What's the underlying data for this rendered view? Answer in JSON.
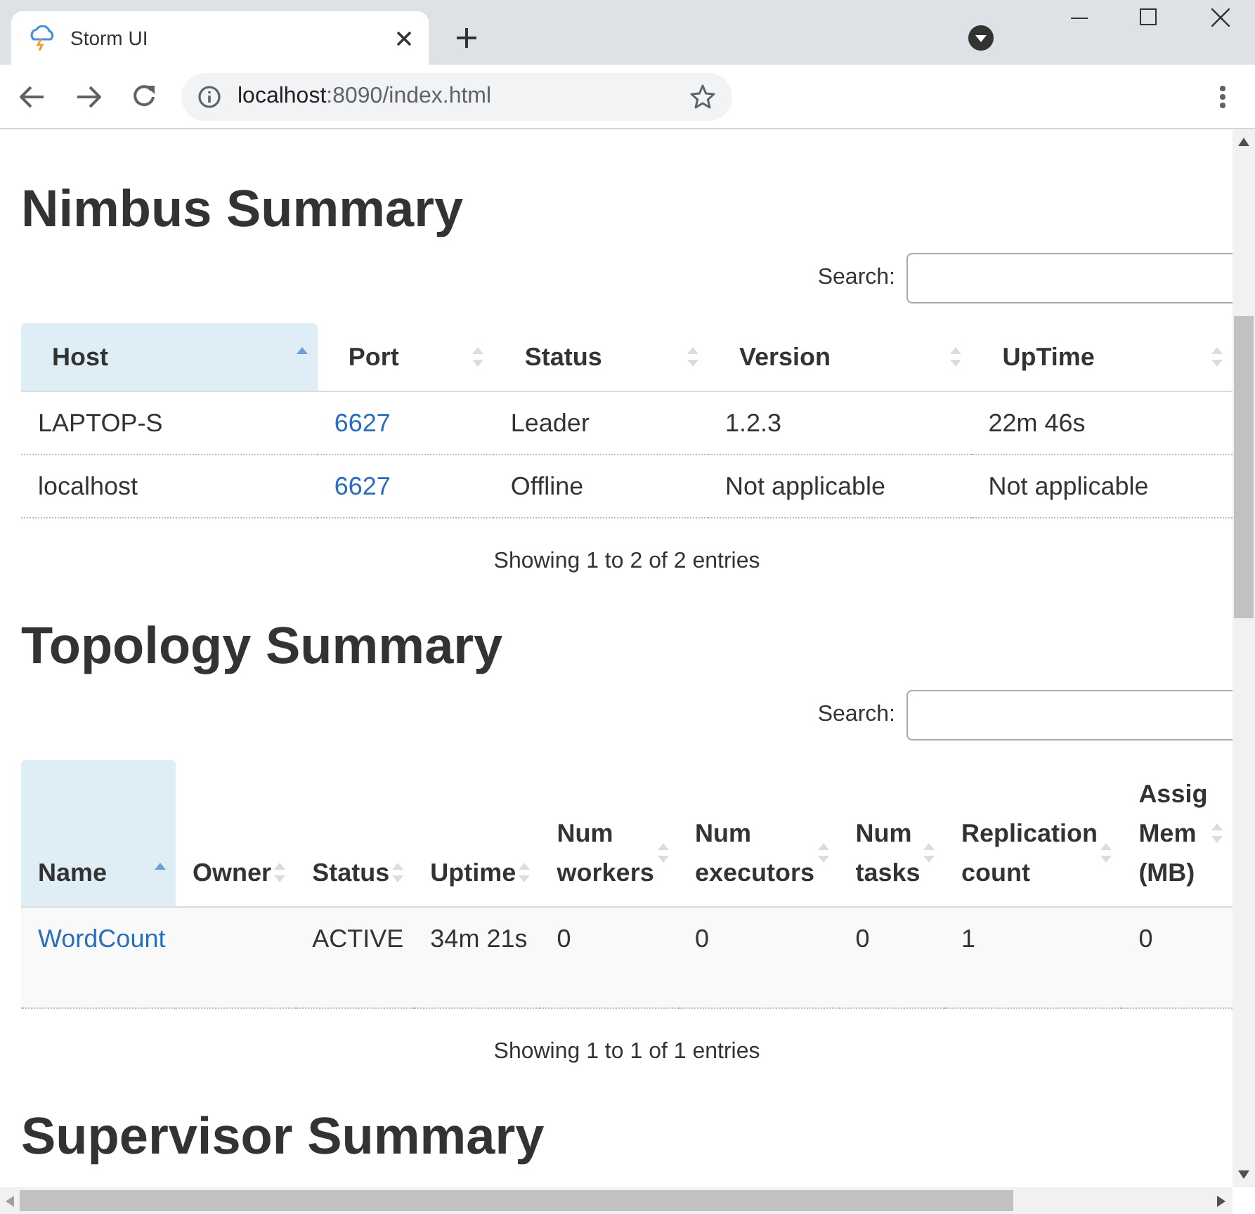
{
  "browser": {
    "tab_title": "Storm UI",
    "address_host": "localhost",
    "address_rest": ":8090/index.html"
  },
  "sections": [
    {
      "title": "Nimbus Summary",
      "search_label": "Search:",
      "columns": [
        {
          "label": "Host",
          "sorted": true
        },
        {
          "label": "Port",
          "sorted": false
        },
        {
          "label": "Status",
          "sorted": false
        },
        {
          "label": "Version",
          "sorted": false
        },
        {
          "label": "UpTime",
          "sorted": false
        }
      ],
      "rows": [
        [
          {
            "text": "LAPTOP-S",
            "kind": "text"
          },
          {
            "text": "6627",
            "kind": "link"
          },
          {
            "text": "Leader",
            "kind": "text"
          },
          {
            "text": "1.2.3",
            "kind": "text"
          },
          {
            "text": "22m 46s",
            "kind": "text"
          }
        ],
        [
          {
            "text": "localhost",
            "kind": "text"
          },
          {
            "text": "6627",
            "kind": "link"
          },
          {
            "text": "Offline",
            "kind": "text"
          },
          {
            "text": "Not applicable",
            "kind": "text"
          },
          {
            "text": "Not applicable",
            "kind": "text"
          }
        ]
      ],
      "info": "Showing 1 to 2 of 2 entries"
    },
    {
      "title": "Topology Summary",
      "search_label": "Search:",
      "columns": [
        {
          "label": "Name",
          "sorted": true
        },
        {
          "label": "Owner",
          "sorted": false
        },
        {
          "label": "Status",
          "sorted": false
        },
        {
          "label": "Uptime",
          "sorted": false
        },
        {
          "label": "Num workers",
          "sorted": false
        },
        {
          "label": "Num executors",
          "sorted": false
        },
        {
          "label": "Num tasks",
          "sorted": false
        },
        {
          "label": "Replication count",
          "sorted": false
        },
        {
          "label": "Assig Mem (MB)",
          "sorted": false
        }
      ],
      "rows": [
        [
          {
            "text": "WordCount",
            "kind": "link"
          },
          {
            "kind": "blank"
          },
          {
            "text": "ACTIVE",
            "kind": "text"
          },
          {
            "text": "34m 21s",
            "kind": "text"
          },
          {
            "text": "0",
            "kind": "text"
          },
          {
            "text": "0",
            "kind": "text"
          },
          {
            "text": "0",
            "kind": "text"
          },
          {
            "text": "1",
            "kind": "text"
          },
          {
            "text": "0",
            "kind": "text"
          }
        ]
      ],
      "info": "Showing 1 to 1 of 1 entries"
    },
    {
      "title": "Supervisor Summary"
    }
  ]
}
